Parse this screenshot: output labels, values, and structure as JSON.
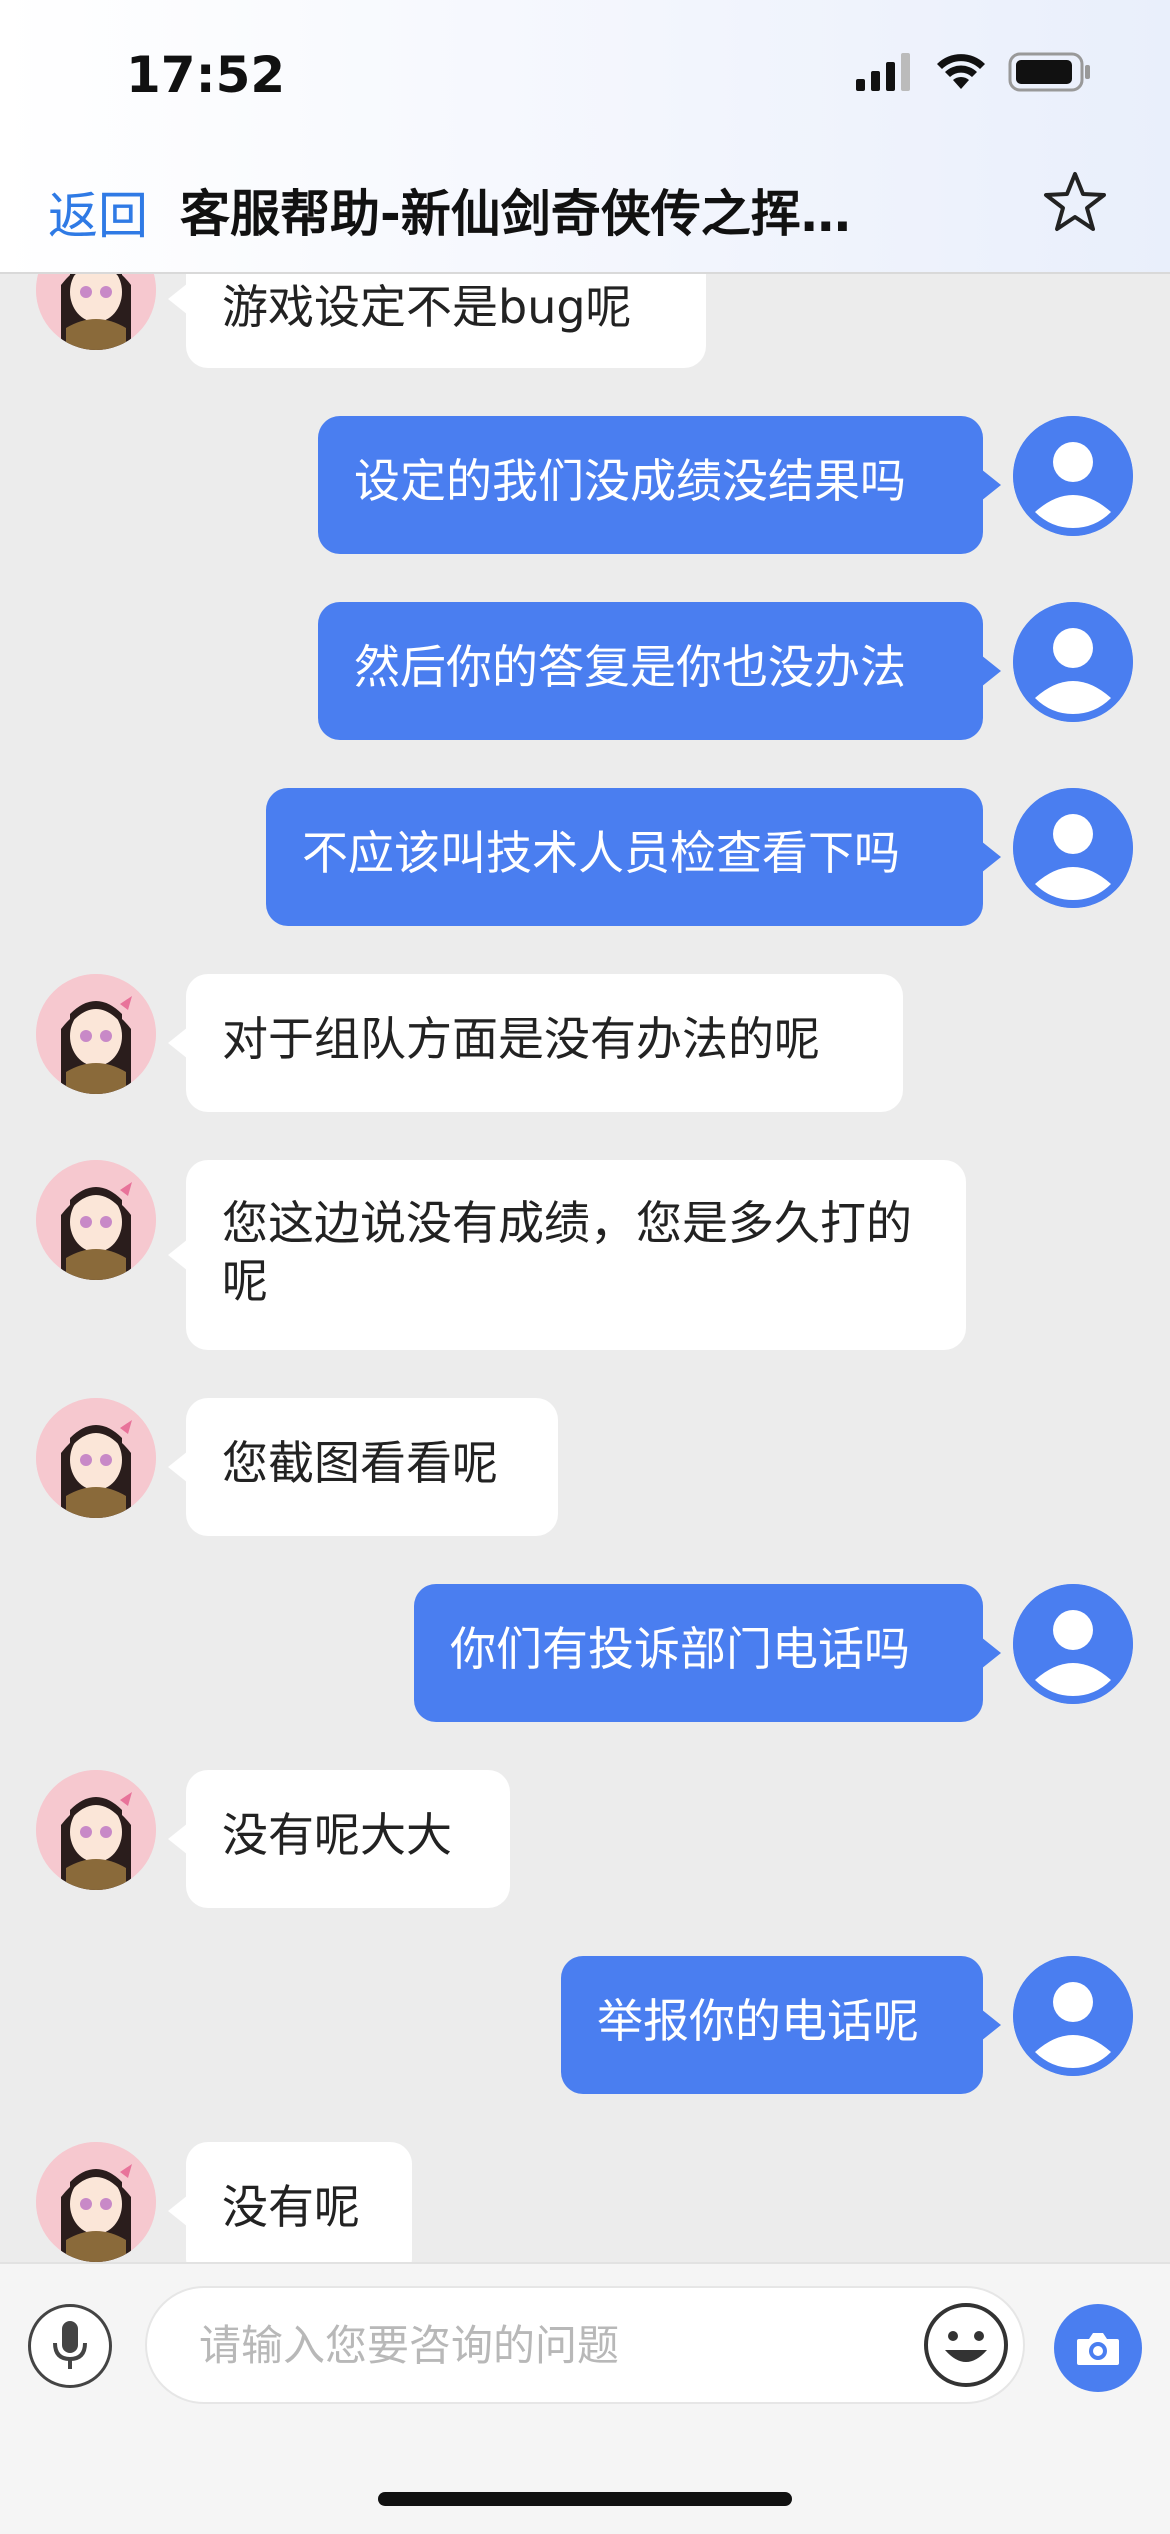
{
  "status_bar": {
    "time": "17:52"
  },
  "nav": {
    "back_label": "返回",
    "title": "客服帮助-新仙剑奇侠传之挥…"
  },
  "messages": [
    {
      "side": "left",
      "text": "游戏设定不是bug呢"
    },
    {
      "side": "right",
      "text": "设定的我们没成绩没结果吗"
    },
    {
      "side": "right",
      "text": "然后你的答复是你也没办法"
    },
    {
      "side": "right",
      "text": "不应该叫技术人员检查看下吗"
    },
    {
      "side": "left",
      "text": "对于组队方面是没有办法的呢"
    },
    {
      "side": "left",
      "text": "您这边说没有成绩，您是多久打的呢"
    },
    {
      "side": "left",
      "text": "您截图看看呢"
    },
    {
      "side": "right",
      "text": "你们有投诉部门电话吗"
    },
    {
      "side": "left",
      "text": "没有呢大大"
    },
    {
      "side": "right",
      "text": "举报你的电话呢"
    },
    {
      "side": "left",
      "text": "没有呢"
    }
  ],
  "input": {
    "placeholder": "请输入您要咨询的问题",
    "value": ""
  },
  "icons": {
    "mic": "microphone-icon",
    "emoji": "smiley-icon",
    "camera": "camera-icon",
    "star": "star-icon",
    "signal": "cellular-signal-icon",
    "wifi": "wifi-icon",
    "battery": "battery-icon"
  },
  "colors": {
    "accent": "#4a7ef0",
    "back_link": "#2f7ae5",
    "chat_bg": "#ececec"
  }
}
